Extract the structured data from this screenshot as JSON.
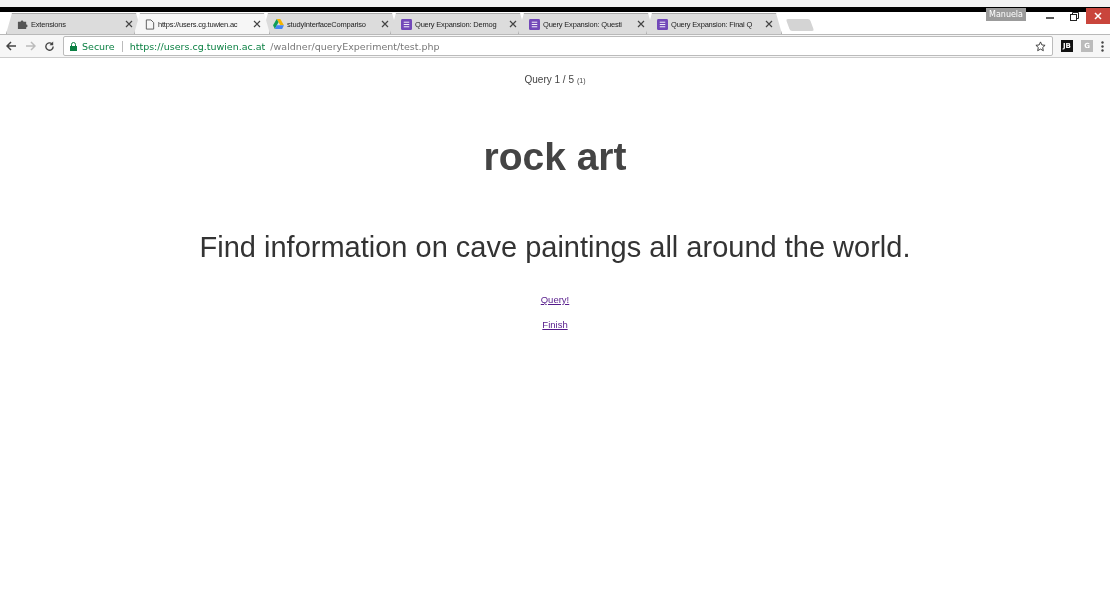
{
  "tabs": [
    {
      "kind": "puzzle",
      "title": "Extensions",
      "selected": false
    },
    {
      "kind": "page",
      "title": "https://users.cg.tuwien.ac",
      "selected": true
    },
    {
      "kind": "drive",
      "title": "studyInterfaceCompariso",
      "selected": false
    },
    {
      "kind": "form",
      "title": "Query Expansion: Demog",
      "selected": false
    },
    {
      "kind": "form",
      "title": "Query Expansion: Questi",
      "selected": false
    },
    {
      "kind": "form",
      "title": "Query Expansion: Final Q",
      "selected": false
    }
  ],
  "profile": "Manuela",
  "address_bar": {
    "secure_label": "Secure",
    "url_host": "https://users.cg.tuwien.ac.at",
    "url_path": "/waldner/queryExperiment/test.php"
  },
  "extensions": [
    "JB",
    "G"
  ],
  "page": {
    "progress": "Query 1 / 5",
    "progress_note": "(1)",
    "topic": "rock art",
    "description": "Find information on cave paintings all around the world.",
    "links": [
      "Query!",
      "Finish"
    ]
  }
}
